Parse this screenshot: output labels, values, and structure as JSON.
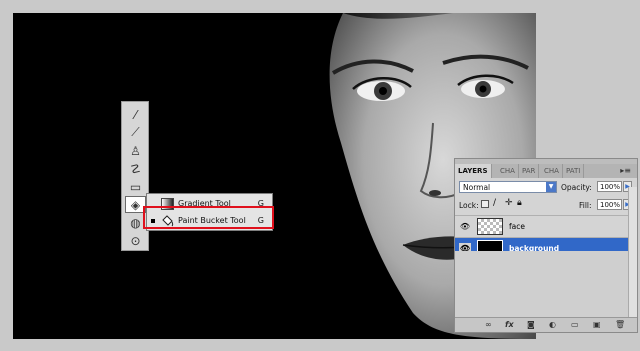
{
  "flyout": {
    "items": [
      {
        "label": "Gradient Tool",
        "key": "G"
      },
      {
        "label": "Paint Bucket Tool",
        "key": "G"
      }
    ]
  },
  "layers_panel": {
    "tabs": [
      "LAYERS",
      "CHA",
      "PAR",
      "CHA",
      "PATI"
    ],
    "blend_mode": "Normal",
    "opacity_label": "Opacity:",
    "opacity_value": "100%",
    "lock_label": "Lock:",
    "fill_label": "Fill:",
    "fill_value": "100%",
    "layers": [
      {
        "name": "face",
        "selected": false
      },
      {
        "name": "background",
        "selected": true
      }
    ],
    "bottom_icons": [
      "link-icon",
      "fx-icon",
      "mask-icon",
      "adjustment-icon",
      "group-icon",
      "new-layer-icon",
      "trash-icon"
    ]
  },
  "colors": {
    "highlight": "#e0101c",
    "selection": "#3168c8",
    "canvas_bg": "#000000"
  },
  "tools": [
    "eyedropper-icon",
    "brush-icon",
    "stamp-icon",
    "history-brush-icon",
    "eraser-icon",
    "paint-bucket-icon",
    "blur-icon",
    "dodge-icon"
  ]
}
